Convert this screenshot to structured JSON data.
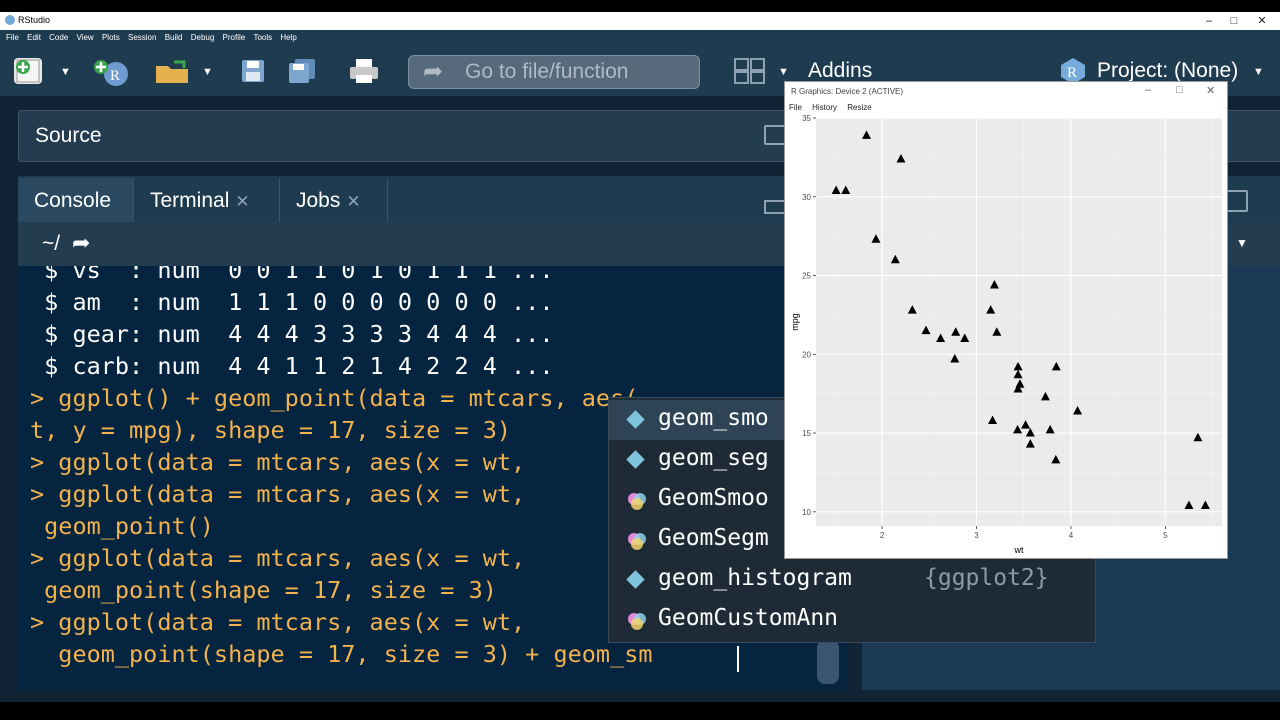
{
  "window": {
    "title": "RStudio"
  },
  "menubar": [
    "File",
    "Edit",
    "Code",
    "View",
    "Plots",
    "Session",
    "Build",
    "Debug",
    "Profile",
    "Tools",
    "Help"
  ],
  "toolbar": {
    "goto_placeholder": "Go to file/function",
    "addins_label": "Addins",
    "project_label": "Project: (None)"
  },
  "source_pane": {
    "label": "Source"
  },
  "console_tabs": [
    {
      "label": "Console"
    },
    {
      "label": "Terminal"
    },
    {
      "label": "Jobs"
    }
  ],
  "path": "~/",
  "console_lines": [
    {
      "text": " $ vs  : num  0 0 1 1 0 1 0 1 1 1 ...",
      "kind": "out"
    },
    {
      "text": " $ am  : num  1 1 1 0 0 0 0 0 0 0 ...",
      "kind": "out"
    },
    {
      "text": " $ gear: num  4 4 4 3 3 3 3 4 4 4 ...",
      "kind": "out"
    },
    {
      "text": " $ carb: num  4 4 1 1 2 1 4 2 2 4 ...",
      "kind": "out"
    },
    {
      "text": "> ggplot() + geom_point(data = mtcars, aes(",
      "kind": "cmd"
    },
    {
      "text": "t, y = mpg), shape = 17, size = 3)",
      "kind": "cmd"
    },
    {
      "text": "> ggplot(data = mtcars, aes(x = wt,",
      "kind": "cmd"
    },
    {
      "text": "> ggplot(data = mtcars, aes(x = wt,",
      "kind": "cmd"
    },
    {
      "text": " geom_point()",
      "kind": "cmd"
    },
    {
      "text": "> ggplot(data = mtcars, aes(x = wt,",
      "kind": "cmd"
    },
    {
      "text": " geom_point(shape = 17, size = 3)",
      "kind": "cmd"
    },
    {
      "text": "> ggplot(data = mtcars, aes(x = wt,",
      "kind": "cmd"
    },
    {
      "text": "  geom_point(shape = 17, size = 3) + geom_sm",
      "kind": "cmd"
    }
  ],
  "autocomplete": [
    {
      "name": "geom_smo",
      "pkg": "",
      "icon": "function-diamond-icon",
      "selected": true
    },
    {
      "name": "geom_seg",
      "pkg": "",
      "icon": "function-diamond-icon",
      "selected": false
    },
    {
      "name": "GeomSmoo",
      "pkg": "",
      "icon": "object-circles-icon",
      "selected": false
    },
    {
      "name": "GeomSegm",
      "pkg": "",
      "icon": "object-circles-icon",
      "selected": false
    },
    {
      "name": "geom_histogram",
      "pkg": "{ggplot2}",
      "icon": "function-diamond-icon",
      "selected": false
    },
    {
      "name": "GeomCustomAnn",
      "pkg": "",
      "icon": "object-circles-icon",
      "selected": false
    }
  ],
  "graphics_window": {
    "title": "R Graphics: Device 2 (ACTIVE)",
    "menu": [
      "File",
      "History",
      "Resize"
    ]
  },
  "chart_data": {
    "type": "scatter",
    "xlabel": "wt",
    "ylabel": "mpg",
    "xlim": [
      1.3,
      5.6
    ],
    "ylim": [
      9.1,
      35
    ],
    "x_ticks": [
      2,
      3,
      4,
      5
    ],
    "y_ticks": [
      10,
      15,
      20,
      25,
      30,
      35
    ],
    "points": [
      [
        2.62,
        21.0
      ],
      [
        2.875,
        21.0
      ],
      [
        2.32,
        22.8
      ],
      [
        3.215,
        21.4
      ],
      [
        3.44,
        18.7
      ],
      [
        3.46,
        18.1
      ],
      [
        3.57,
        14.3
      ],
      [
        3.19,
        24.4
      ],
      [
        3.15,
        22.8
      ],
      [
        3.44,
        19.2
      ],
      [
        3.44,
        17.8
      ],
      [
        4.07,
        16.4
      ],
      [
        3.73,
        17.3
      ],
      [
        3.78,
        15.2
      ],
      [
        5.25,
        10.4
      ],
      [
        5.424,
        10.4
      ],
      [
        5.345,
        14.7
      ],
      [
        2.2,
        32.4
      ],
      [
        1.615,
        30.4
      ],
      [
        1.835,
        33.9
      ],
      [
        2.465,
        21.5
      ],
      [
        3.52,
        15.5
      ],
      [
        3.435,
        15.2
      ],
      [
        3.84,
        13.3
      ],
      [
        3.845,
        19.2
      ],
      [
        1.935,
        27.3
      ],
      [
        2.14,
        26.0
      ],
      [
        1.513,
        30.4
      ],
      [
        3.17,
        15.8
      ],
      [
        2.77,
        19.7
      ],
      [
        3.57,
        15.0
      ],
      [
        2.78,
        21.4
      ]
    ],
    "marker": "triangle",
    "grid": true,
    "background": "#ebebeb"
  }
}
